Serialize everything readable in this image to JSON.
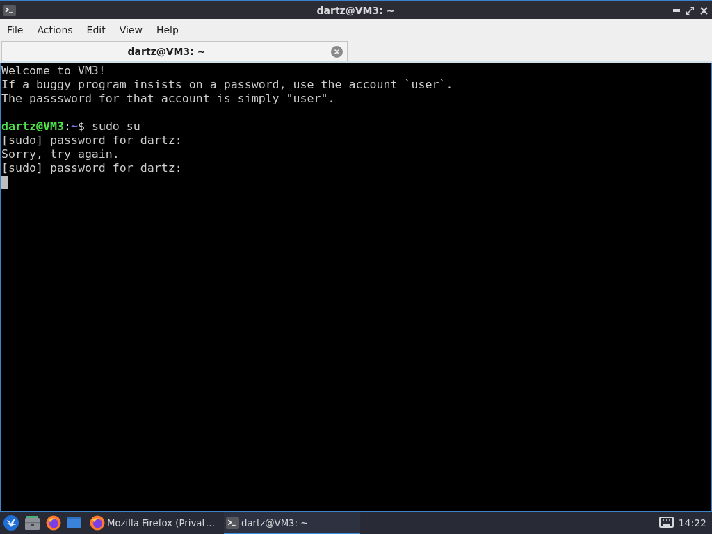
{
  "window": {
    "title": "dartz@VM3: ~"
  },
  "menu_bar": {
    "items": [
      "File",
      "Actions",
      "Edit",
      "View",
      "Help"
    ]
  },
  "tabs": [
    {
      "label": "dartz@VM3: ~",
      "selected": true
    }
  ],
  "terminal": {
    "lines": [
      {
        "kind": "output",
        "text": "Welcome to VM3!"
      },
      {
        "kind": "output",
        "text": "If a buggy program insists on a password, use the account `user`."
      },
      {
        "kind": "output",
        "text": "The passsword for that account is simply \"user\"."
      },
      {
        "kind": "blank"
      },
      {
        "kind": "prompt",
        "user_host": "dartz@VM3",
        "separator": ":",
        "path": "~",
        "symbol": "$",
        "command": "sudo su"
      },
      {
        "kind": "output",
        "text": "[sudo] password for dartz:"
      },
      {
        "kind": "output",
        "text": "Sorry, try again."
      },
      {
        "kind": "output",
        "text": "[sudo] password for dartz:"
      }
    ]
  },
  "taskbar": {
    "tasks": [
      {
        "kind": "browser",
        "label": "Mozilla Firefox (Privat…",
        "selected": false
      },
      {
        "kind": "terminal",
        "label": "dartz@VM3: ~",
        "selected": true
      }
    ],
    "clock": "14:22"
  }
}
